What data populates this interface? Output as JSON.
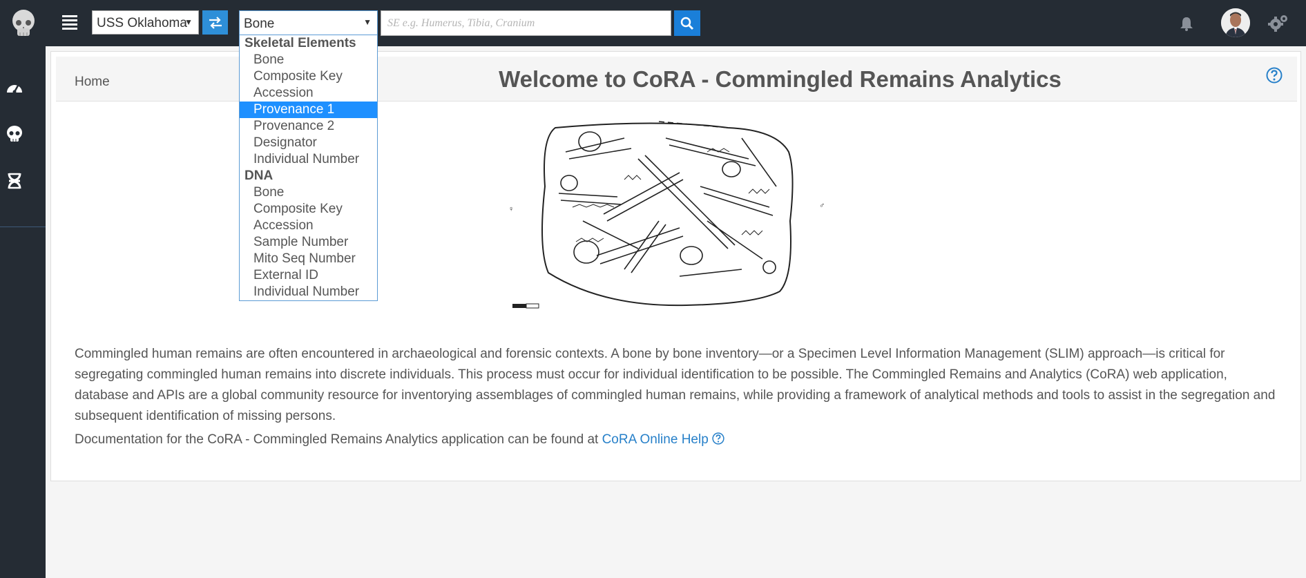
{
  "topbar": {
    "project_value": "USS Oklahoma",
    "field_value": "Bone",
    "search_placeholder": "SE e.g. Humerus, Tibia, Cranium",
    "icons": [
      "skull-logo-icon",
      "menu-icon",
      "swap-icon",
      "search-icon",
      "bell-icon",
      "avatar",
      "gears-icon"
    ]
  },
  "dropdown": {
    "groups": [
      {
        "label": "Skeletal Elements",
        "options": [
          "Bone",
          "Composite Key",
          "Accession",
          "Provenance 1",
          "Provenance 2",
          "Designator",
          "Individual Number"
        ]
      },
      {
        "label": "DNA",
        "options": [
          "Bone",
          "Composite Key",
          "Accession",
          "Sample Number",
          "Mito Seq Number",
          "External ID",
          "Individual Number"
        ]
      }
    ],
    "selected": "Provenance 1"
  },
  "sidebar": {
    "icons": [
      "dashboard-icon",
      "skull-icon",
      "dna-icon"
    ]
  },
  "main": {
    "breadcrumb": "Home",
    "title": "Welcome to CoRA - Commingled Remains Analytics",
    "intro": "Commingled human remains are often encountered in archaeological and forensic contexts. A bone by bone inventory—or a Specimen Level Information Management (SLIM) approach—is critical for segregating commingled human remains into discrete individuals. This process must occur for individual identification to be possible. The Commingled Remains and Analytics (CoRA) web application, database and APIs are a global community resource for inventorying assemblages of commingled human remains, while providing a framework of analytical methods and tools to assist in the segregation and subsequent identification of missing persons.",
    "doc_prefix": "Documentation for the CoRA - Commingled Remains Analytics application can be found at ",
    "doc_link": "CoRA Online Help"
  },
  "colors": {
    "topbar_bg": "#252c34",
    "accent_blue": "#1a7fd9",
    "selected_option": "#1e90ff",
    "link": "#2780c9"
  }
}
